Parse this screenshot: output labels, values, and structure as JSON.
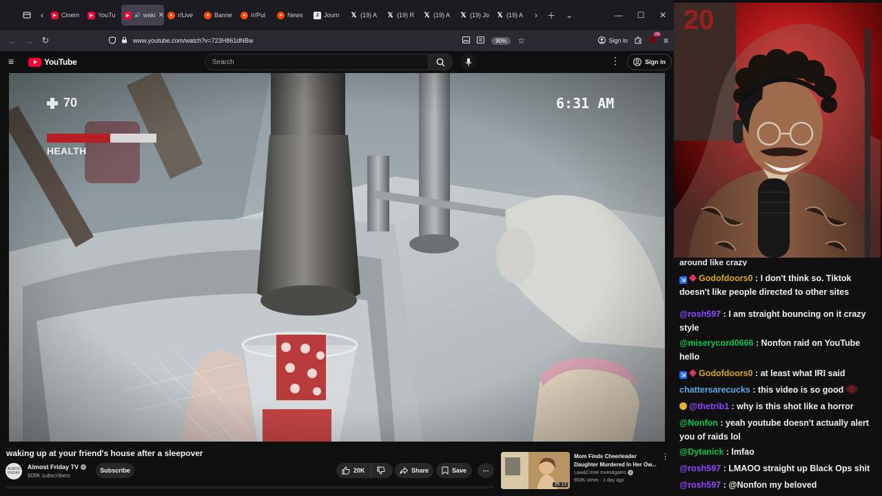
{
  "browser": {
    "tabs": [
      {
        "label": "Cinem",
        "favicon": "youtube-icon",
        "kind": "yt"
      },
      {
        "label": "YouTu",
        "favicon": "youtube-icon",
        "kind": "yt"
      },
      {
        "label": "waki",
        "favicon": "youtube-icon",
        "kind": "yt",
        "active": true
      },
      {
        "label": "r/Live",
        "favicon": "reddit-icon",
        "kind": "rd"
      },
      {
        "label": "Banne",
        "favicon": "reddit-icon",
        "kind": "rd"
      },
      {
        "label": "/r/Pul",
        "favicon": "reddit-icon",
        "kind": "rd"
      },
      {
        "label": "News",
        "favicon": "reddit-icon",
        "kind": "rd"
      },
      {
        "label": "Journ",
        "favicon": "journal-icon",
        "kind": "jn"
      },
      {
        "label": "(19) A",
        "favicon": "x-icon",
        "kind": "x"
      },
      {
        "label": "(19) R",
        "favicon": "x-icon",
        "kind": "x"
      },
      {
        "label": "(19) A",
        "favicon": "x-icon",
        "kind": "x"
      },
      {
        "label": "(19) Jo",
        "favicon": "x-icon",
        "kind": "x"
      },
      {
        "label": "(19) A",
        "favicon": "x-icon",
        "kind": "x"
      }
    ],
    "url": "www.youtube.com/watch?v=723H861dNBw",
    "zoom": "90%",
    "signin_label": "Sign in",
    "extensions_badge": "23"
  },
  "youtube": {
    "logo_text": "YouTube",
    "search_placeholder": "Search",
    "signin_label": "Sign in",
    "brand_color": "#ff0033"
  },
  "video": {
    "hud": {
      "health_value": "70",
      "health_label": "HEALTH",
      "health_fraction": 0.58,
      "time": "6:31 AM"
    },
    "title": "waking up at your friend's house after a sleepover",
    "channel": {
      "name": "Almost Friday TV",
      "subscribers": "909K subscribers",
      "avatar_text": "ALMOST FRIDAY"
    },
    "subscribe_label": "Subscribe",
    "likes": "20K",
    "share_label": "Share",
    "save_label": "Save"
  },
  "recommendation": {
    "title": "Mom Finds Cheerleader Daughter Murdered In Her Ow...",
    "channel": "Law&Crime Investigates",
    "meta": "653K views · 1 day ago",
    "duration": "35:13"
  },
  "chat": {
    "cut_line": "around like crazy",
    "messages": [
      {
        "user": "Godofdoors0",
        "color": "#daa520",
        "badges": [
          "blue",
          "gem"
        ],
        "text": "I don't think so. Tiktok doesn't like people directed to other sites"
      },
      {
        "user": "@rosh597",
        "color": "#9146ff",
        "badges": [],
        "text": "I am straight bouncing on it crazy style"
      },
      {
        "user": "@miserycord0666",
        "color": "#00c853",
        "badges": [],
        "text": "Nonfon raid on YouTube hello"
      },
      {
        "user": "Godofdoors0",
        "color": "#daa520",
        "badges": [
          "blue",
          "gem"
        ],
        "text": "at least what IRI said"
      },
      {
        "user": "chattersarecucks",
        "color": "#5aa9e6",
        "badges": [],
        "text": "this video is so good",
        "emote": true
      },
      {
        "user": "@thetrib1",
        "color": "#9146ff",
        "badges": [
          "coin"
        ],
        "text": "why is this shot like a horror"
      },
      {
        "user": "@Nonfon",
        "color": "#00c853",
        "badges": [],
        "text": "yeah youtube doesn't actually alert you of raids lol"
      },
      {
        "user": "@Dytanick",
        "color": "#00c853",
        "badges": [],
        "text": "lmfao"
      },
      {
        "user": "@rosh597",
        "color": "#9146ff",
        "badges": [],
        "text": "LMAOO straight up Black Ops shit"
      },
      {
        "user": "@rosh597",
        "color": "#9146ff",
        "badges": [],
        "text": "@Nonfon my beloved"
      }
    ]
  }
}
